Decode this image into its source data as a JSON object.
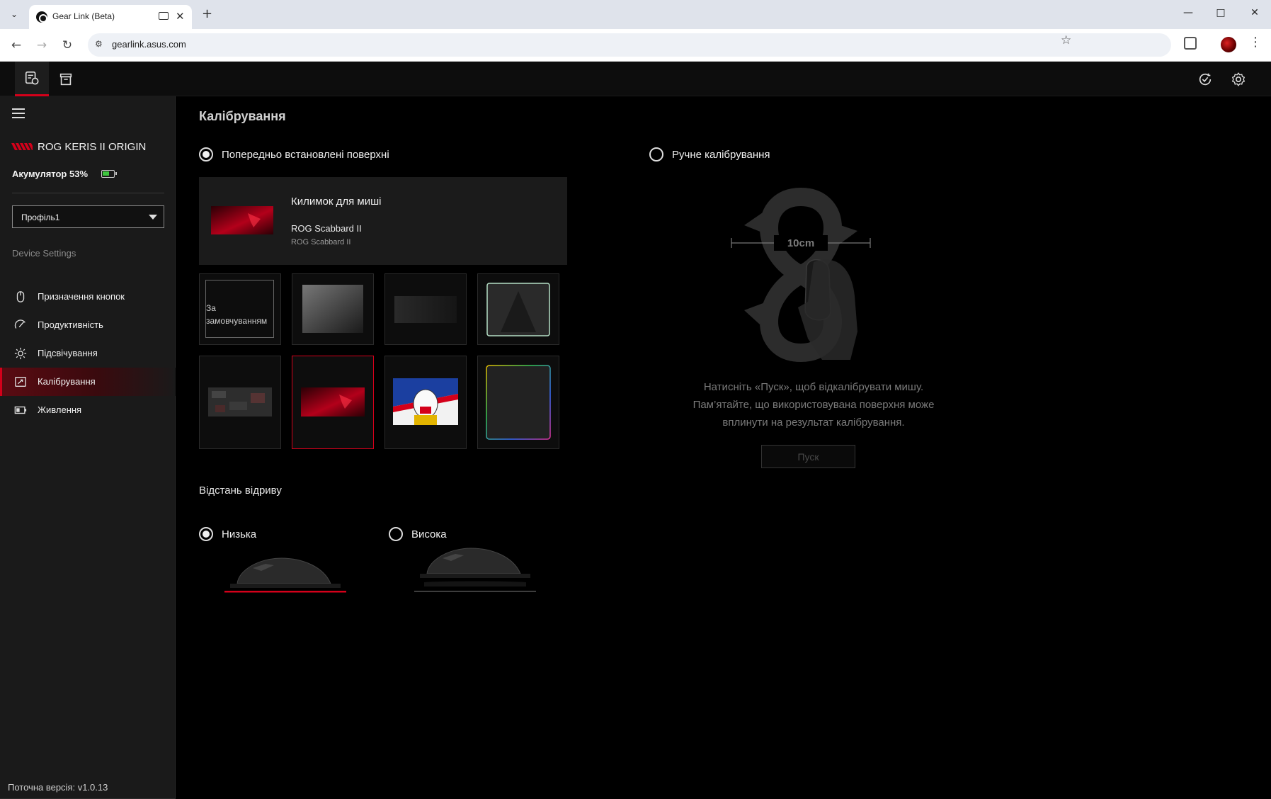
{
  "browser": {
    "tab_title": "Gear Link (Beta)",
    "url": "gearlink.asus.com"
  },
  "sidebar": {
    "device_name": "ROG KERIS II ORIGIN",
    "battery_label": "Акумулятор 53%",
    "battery_percent": 53,
    "profile_value": "Профіль1",
    "section_title": "Device Settings",
    "items": [
      {
        "label": "Призначення кнопок",
        "icon": "mouse-icon"
      },
      {
        "label": "Продуктивність",
        "icon": "performance-gauge-icon"
      },
      {
        "label": "Підсвічування",
        "icon": "lighting-sun-icon"
      },
      {
        "label": "Калібрування",
        "icon": "calibration-icon",
        "active": true
      },
      {
        "label": "Живлення",
        "icon": "battery-power-icon"
      }
    ],
    "version": "Поточна версія: v1.0.13"
  },
  "main": {
    "title": "Калібрування",
    "preset_radio_label": "Попередньо встановлені поверхні",
    "manual_radio_label": "Ручне калібрування",
    "pad_info": {
      "title": "Килимок для миші",
      "name": "ROG Scabbard II",
      "subtitle": "ROG Scabbard II"
    },
    "pads": {
      "default_label": "За замовчуванням",
      "selected_index": 5
    },
    "lift_title": "Відстань відриву",
    "lift_low": "Низька",
    "lift_high": "Висока",
    "manual": {
      "distance_label": "10cm",
      "description_line1": "Натисніть «Пуск», щоб відкалібрувати мишу.",
      "description_line2": "Пам’ятайте, що використовувана поверхня може",
      "description_line3": "вплинути на результат калібрування.",
      "start_button": "Пуск"
    }
  },
  "colors": {
    "accent_red": "#d4001a",
    "battery_green": "#3ec63e"
  }
}
